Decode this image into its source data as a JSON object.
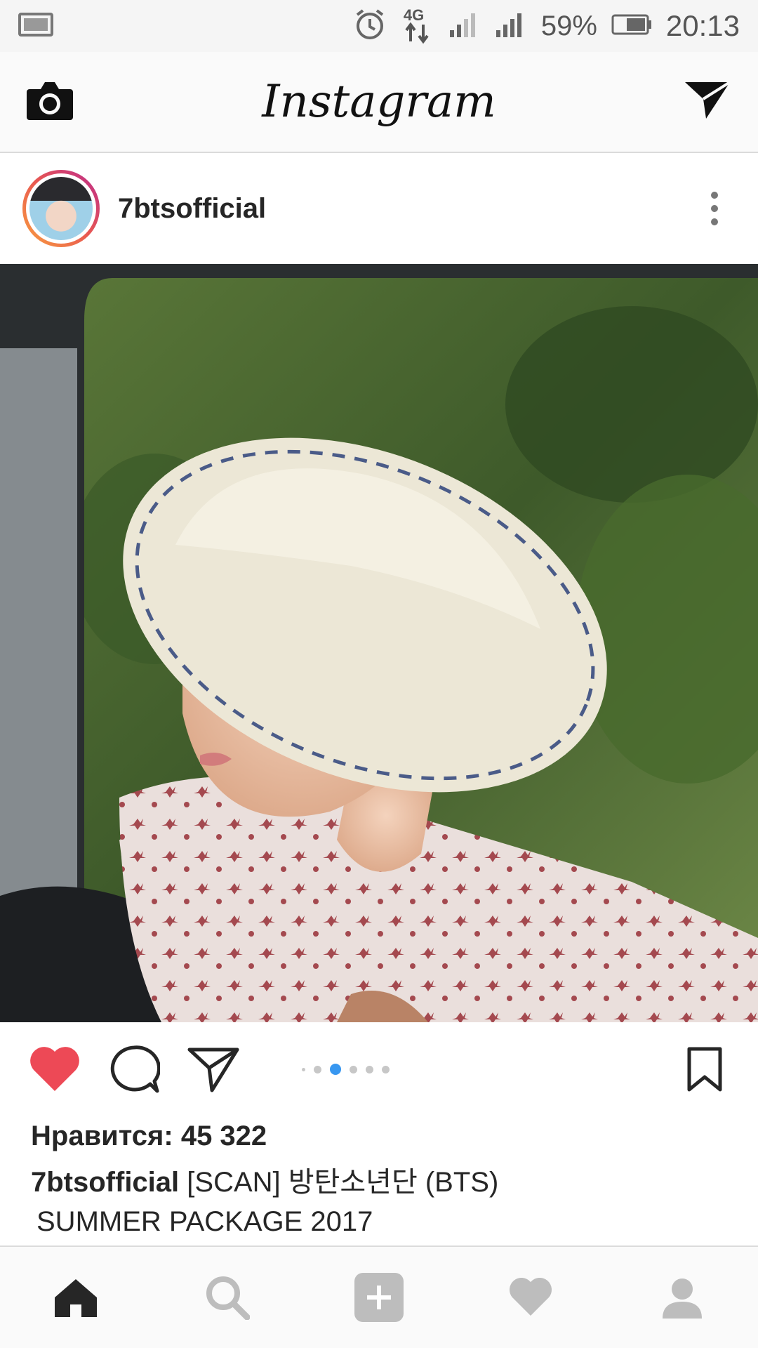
{
  "status_bar": {
    "network": "4G",
    "battery": "59%",
    "time": "20:13",
    "icons": [
      "gallery-notification-icon",
      "alarm-icon",
      "data-transfer-icon",
      "signal-icon",
      "signal-icon",
      "battery-icon"
    ]
  },
  "app_bar": {
    "title": "Instagram",
    "left_icon": "camera-icon",
    "right_icon": "direct-message-icon"
  },
  "post": {
    "username": "7btsofficial",
    "more_icon": "more-vertical-icon",
    "image_alt": "",
    "carousel": {
      "count": 6,
      "active_index": 1
    },
    "likes_text": "Нравится: 45 322",
    "caption_user": "7btsofficial",
    "caption_text": "[SCAN] 방탄소년단 (BTS)",
    "caption_line2": "SUMMER PACKAGE 2017",
    "colors": {
      "like_red": "#ed4956",
      "dot_active": "#3897f0"
    }
  },
  "bottom_nav": {
    "items": [
      "home-icon",
      "search-icon",
      "add-post-icon",
      "activity-heart-icon",
      "profile-icon"
    ]
  }
}
